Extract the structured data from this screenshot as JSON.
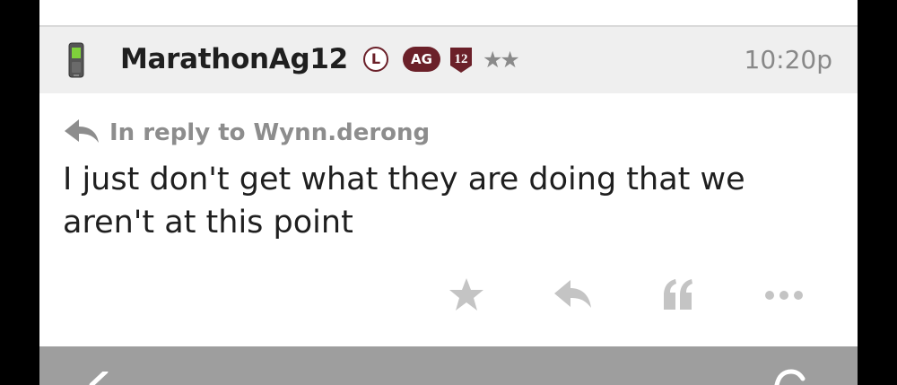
{
  "post": {
    "username": "MarathonAg12",
    "badges": {
      "l": "L",
      "ag": "AG",
      "number": "12"
    },
    "stars": "★★",
    "timestamp": "10:20p",
    "reply_to": "In reply to Wynn.derong",
    "message": "I just don't get what they are doing that we aren't at this point"
  },
  "icons": {
    "device": "mobile-phone-icon",
    "reply": "reply-arrow-icon",
    "star": "star-icon",
    "quote": "quote-icon",
    "more": "more-dots-icon"
  },
  "colors": {
    "badge": "#6b2029",
    "header_bg": "#efefef",
    "muted": "#8d8d8d",
    "action_icon": "#c4c4c4",
    "bottom_bar": "#9e9e9e"
  }
}
